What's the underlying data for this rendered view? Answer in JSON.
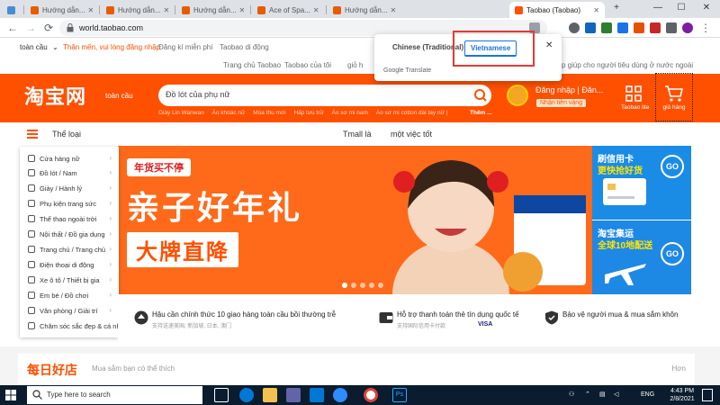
{
  "browser": {
    "tabs": [
      {
        "title": "",
        "favicon_color": "#4a8bd6"
      },
      {
        "title": "Hướng dẫn...",
        "favicon_color": "#e65c00"
      },
      {
        "title": "Hướng dẫn...",
        "favicon_color": "#e65c00"
      },
      {
        "title": "Hướng dẫn...",
        "favicon_color": "#e65c00"
      },
      {
        "title": "Ace of Spa...",
        "favicon_color": "#e65c00"
      },
      {
        "title": "Hướng dẫn...",
        "favicon_color": "#e65c00"
      },
      {
        "title": "Taobao (Taobao)",
        "favicon_color": "#ff5000",
        "active": true
      }
    ],
    "new_tab": "+",
    "window_controls": {
      "minimize": "—",
      "maximize": "☐",
      "close": "✕"
    },
    "url": "world.taobao.com"
  },
  "toplinks": {
    "region": "toàn cầu",
    "welcome": "Thân mến, vui lòng đăng nhập",
    "register": "Đăng kí miễn phí",
    "mobile": "Taobao di động",
    "home": "Trang chủ Taobao",
    "my_taobao": "Taobao của tôi",
    "cart_short": "giỏ h",
    "help": "p giúp cho người tiêu dùng ở nước ngoài"
  },
  "header": {
    "logo": "淘宝网",
    "logo_sub": "toàn cầu",
    "search_placeholder": "Đồ lót của phụ nữ",
    "hot_keywords": [
      "Giày Lin Wanwan",
      "Áo khoác nữ",
      "Mùa thu mới",
      "Hấp lưu trữ",
      "Áo sơ mi nam",
      "Áo sơ mi cotton dài tay nữ |"
    ],
    "more": "Thêm ...",
    "login": "Đăng nhập",
    "login_more": "Đăn...",
    "gold_badge": "Nhận tiền vàng",
    "taobao_lite": "Taobao lite",
    "cart": "giỏ hàng"
  },
  "category_row": {
    "title": "Thể loại",
    "tmall": "Tmall là",
    "one_thing": "một việc tốt"
  },
  "categories": [
    "Cửa hàng nữ",
    "Đồ lót / Nam",
    "Giày / Hành lý",
    "Phụ kiện trang sức",
    "Thể thao ngoài trời",
    "Nội thất / Đồ gia dụng",
    "Trang chủ / Trang chủ",
    "Điện thoại di động",
    "Xe ô tô / Thiết bị gia",
    "Em bé / Đồ chơi",
    "Văn phòng / Giải trí",
    "Chăm sóc sắc đẹp & cá nhân"
  ],
  "banner": {
    "tag": "年货买不停",
    "headline": "亲子好年礼",
    "subline": "大牌直降"
  },
  "side_ads": [
    {
      "line1": "刷信用卡",
      "line2": "更快抢好货",
      "go": "GO"
    },
    {
      "line1": "淘宝集运",
      "line2": "全球10地配送",
      "go": "GO"
    }
  ],
  "services": [
    {
      "main": "Hậu cần chính thức 10 giao hàng toàn cầu bồi thường trễ",
      "small": "支持送速美国, 新加坡, 日本, 澳门"
    },
    {
      "main": "Hỗ trợ thanh toán thẻ tín dụng quốc tế",
      "small": "支持国际信用卡付款",
      "cards": "VISA"
    },
    {
      "main": "Bảo vệ người mua & mua sắm khôn",
      "small": ""
    }
  ],
  "daily": {
    "logo": "每日好店",
    "subtitle": "Mua sắm bạn có thể thích",
    "more": "Hơn"
  },
  "translate_popup": {
    "source_lang": "Chinese (Traditional)",
    "target_lang": "Vietnamese",
    "menu": "⋮",
    "close": "✕",
    "brand_google": "Google",
    "brand_translate": "Translate"
  },
  "taskbar": {
    "search_placeholder": "Type here to search",
    "language": "ENG",
    "time": "4:43 PM",
    "date": "2/8/2021"
  },
  "colors": {
    "taobao_orange": "#ff5000",
    "highlight_red": "#e53935",
    "translate_blue": "#1a73e8",
    "taskbar_bg": "#0b1c2e"
  }
}
